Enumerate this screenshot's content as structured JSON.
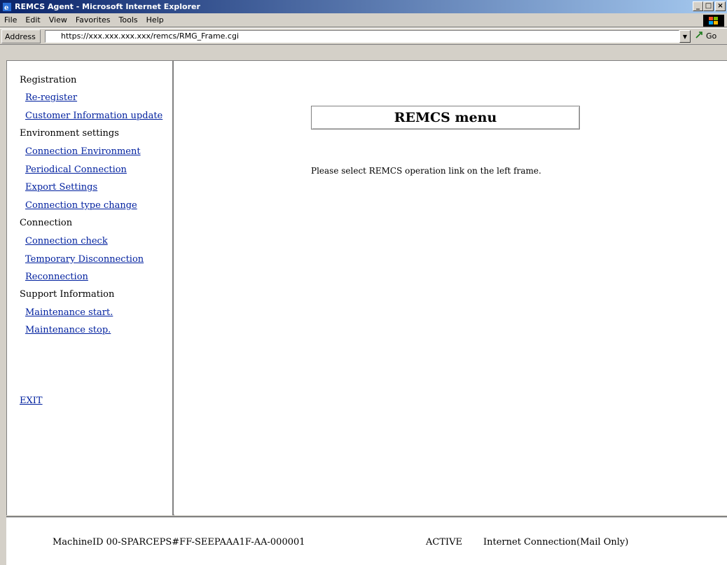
{
  "window": {
    "title": "REMCS Agent - Microsoft Internet Explorer",
    "min_glyph": "_",
    "max_glyph": "□",
    "close_glyph": "×"
  },
  "menubar": {
    "items": [
      {
        "label": "File"
      },
      {
        "label": "Edit"
      },
      {
        "label": "View"
      },
      {
        "label": "Favorites"
      },
      {
        "label": "Tools"
      },
      {
        "label": "Help"
      }
    ]
  },
  "addressbar": {
    "label": "Address",
    "url": "https://xxx.xxx.xxx.xxx/remcs/RMG_Frame.cgi",
    "go_label": "Go"
  },
  "nav": {
    "items": [
      {
        "type": "group",
        "label": "Registration"
      },
      {
        "type": "link",
        "label": "Re-register"
      },
      {
        "type": "link",
        "label": "Customer Information update"
      },
      {
        "type": "group",
        "label": "Environment settings"
      },
      {
        "type": "link",
        "label": "Connection Environment"
      },
      {
        "type": "link",
        "label": "Periodical Connection"
      },
      {
        "type": "link",
        "label": "Export Settings"
      },
      {
        "type": "link",
        "label": "Connection type change"
      },
      {
        "type": "group",
        "label": "Connection"
      },
      {
        "type": "link",
        "label": "Connection check"
      },
      {
        "type": "link",
        "label": "Temporary Disconnection"
      },
      {
        "type": "link",
        "label": "Reconnection"
      },
      {
        "type": "group",
        "label": "Support Information"
      },
      {
        "type": "link",
        "label": "Maintenance start."
      },
      {
        "type": "link",
        "label": "Maintenance stop."
      }
    ],
    "exit_label": "EXIT"
  },
  "main": {
    "title": "REMCS menu",
    "instruction": "Please select REMCS operation link on the left frame."
  },
  "status": {
    "machine_id": "MachineID  00-SPARCEPS#FF-SEEPAAA1F-AA-000001",
    "state": "ACTIVE",
    "connection": "Internet Connection(Mail Only)"
  },
  "colors": {
    "link": "#00209f",
    "titlebar_start": "#0a246a",
    "titlebar_end": "#a6caf0"
  }
}
